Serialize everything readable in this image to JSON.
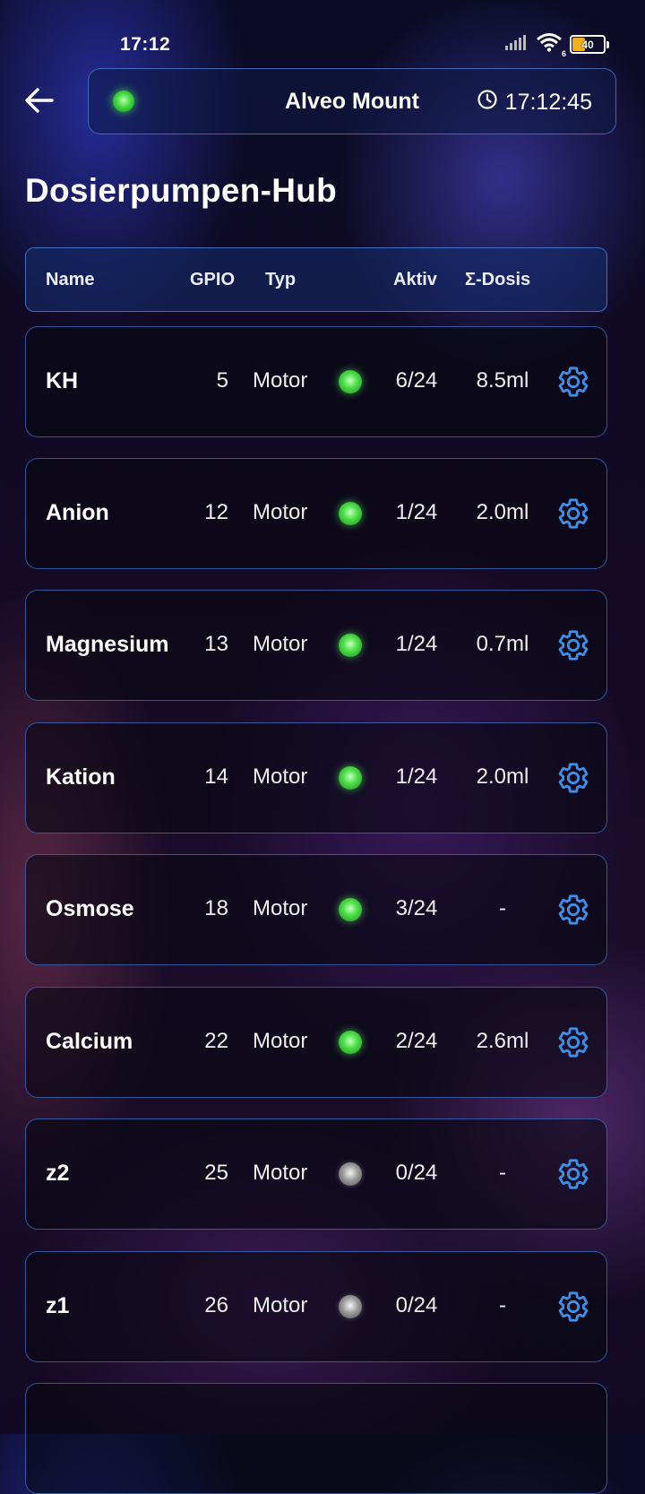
{
  "status_bar": {
    "time": "17:12",
    "battery_level": "40",
    "wifi_label": "6",
    "icons": [
      "signal-icon",
      "wifi-icon",
      "battery-icon"
    ]
  },
  "header": {
    "title": "Alveo Mount",
    "clock": "17:12:45",
    "connection_status_color": "#41d83e"
  },
  "page": {
    "title": "Dosierpumpen-Hub"
  },
  "table": {
    "columns": [
      "Name",
      "GPIO",
      "Typ",
      "Aktiv",
      "Σ-Dosis"
    ],
    "rows": [
      {
        "name": "KH",
        "gpio": "5",
        "typ": "Motor",
        "active": true,
        "aktiv": "6/24",
        "dose": "8.5ml"
      },
      {
        "name": "Anion",
        "gpio": "12",
        "typ": "Motor",
        "active": true,
        "aktiv": "1/24",
        "dose": "2.0ml"
      },
      {
        "name": "Magnesium",
        "gpio": "13",
        "typ": "Motor",
        "active": true,
        "aktiv": "1/24",
        "dose": "0.7ml"
      },
      {
        "name": "Kation",
        "gpio": "14",
        "typ": "Motor",
        "active": true,
        "aktiv": "1/24",
        "dose": "2.0ml"
      },
      {
        "name": "Osmose",
        "gpio": "18",
        "typ": "Motor",
        "active": true,
        "aktiv": "3/24",
        "dose": "-"
      },
      {
        "name": "Calcium",
        "gpio": "22",
        "typ": "Motor",
        "active": true,
        "aktiv": "2/24",
        "dose": "2.6ml"
      },
      {
        "name": "z2",
        "gpio": "25",
        "typ": "Motor",
        "active": false,
        "aktiv": "0/24",
        "dose": "-"
      },
      {
        "name": "z1",
        "gpio": "26",
        "typ": "Motor",
        "active": false,
        "aktiv": "0/24",
        "dose": "-"
      }
    ]
  },
  "colors": {
    "accent": "#3f8fe6",
    "led_active": "#41d83e",
    "led_inactive": "#9a9a9a",
    "border": "#4a7fd6"
  }
}
